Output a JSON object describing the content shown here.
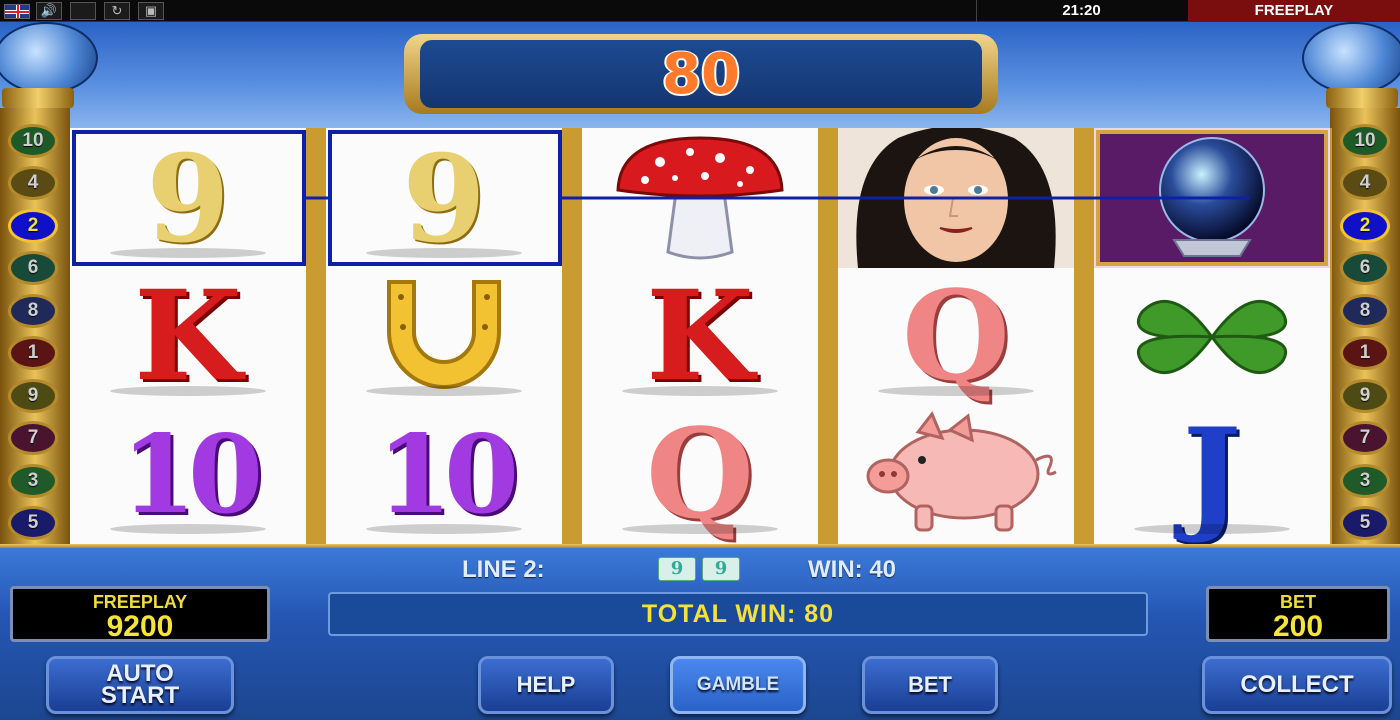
{
  "topbar": {
    "language_flag": "uk-flag-icon",
    "sound_icon": "speaker-icon",
    "clock": "21:20",
    "mode": "FREEPLAY"
  },
  "header": {
    "win_amount": "80"
  },
  "line_markers": {
    "left": [
      "10",
      "4",
      "2",
      "6",
      "8",
      "1",
      "9",
      "7",
      "3",
      "5"
    ],
    "right": [
      "10",
      "4",
      "2",
      "6",
      "8",
      "1",
      "9",
      "7",
      "3",
      "5"
    ],
    "active": "2"
  },
  "reels": [
    [
      "9",
      "K",
      "10"
    ],
    [
      "9",
      "horseshoe",
      "10"
    ],
    [
      "mushroom",
      "K",
      "Q"
    ],
    [
      "fortune-teller",
      "Q",
      "pig"
    ],
    [
      "crystal-ball",
      "clover",
      "J"
    ]
  ],
  "status": {
    "line_label": "LINE 2:",
    "win_label": "WIN: 40",
    "total_win": "TOTAL WIN: 80"
  },
  "meters": {
    "credit_label": "FREEPLAY",
    "credit_value": "9200",
    "bet_label": "BET",
    "bet_value": "200"
  },
  "buttons": {
    "auto_start": "AUTO\nSTART",
    "help": "HELP",
    "gamble": "GAMBLE",
    "bet": "BET",
    "collect": "COLLECT"
  },
  "colors": {
    "win_line": "#0e1fa8",
    "accent_gold": "#e9c25a",
    "total_win_text": "#f4e23a"
  }
}
